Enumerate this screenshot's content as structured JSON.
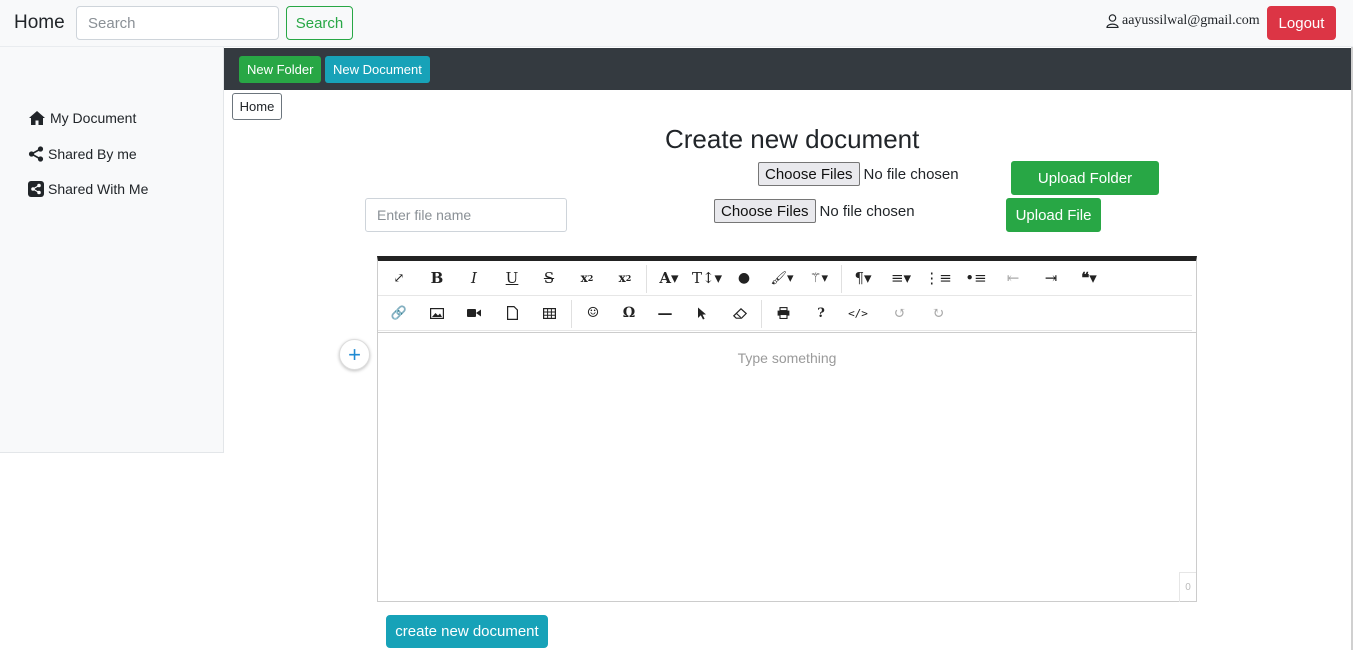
{
  "navbar": {
    "brand": "Home",
    "search_placeholder": "Search",
    "search_label": "Search",
    "user_email": "aayussilwal@gmail.com",
    "logout_label": "Logout"
  },
  "sidebar": {
    "items": [
      {
        "label": "My Document",
        "icon": "home-icon"
      },
      {
        "label": "Shared By me",
        "icon": "share-icon"
      },
      {
        "label": "Shared With Me",
        "icon": "share-square-icon"
      }
    ]
  },
  "toolbar": {
    "new_folder_label": "New Folder",
    "new_document_label": "New Document"
  },
  "breadcrumb": {
    "home": "Home"
  },
  "main": {
    "title": "Create new document",
    "folder_file_input": {
      "button": "Choose Files",
      "status": "No file chosen"
    },
    "upload_folder_label": "Upload Folder",
    "file_input": {
      "button": "Choose Files",
      "status": "No file chosen"
    },
    "upload_file_label": "Upload File",
    "filename_placeholder": "Enter file name",
    "editor": {
      "placeholder": "Type something",
      "char_count": "0",
      "toolbar_row1": [
        "fullscreen",
        "bold",
        "italic",
        "underline",
        "strikethrough",
        "subscript",
        "superscript",
        "font-family",
        "font-size",
        "color",
        "paint-brush",
        "magic-wand",
        "paragraph",
        "align",
        "ordered-list",
        "unordered-list",
        "outdent",
        "indent",
        "quote"
      ],
      "toolbar_row2": [
        "link",
        "image",
        "video",
        "file",
        "table",
        "emoticon",
        "special-char",
        "horizontal-line",
        "select-all",
        "clear-formatting",
        "print",
        "help",
        "html",
        "undo",
        "redo"
      ]
    },
    "create_label": "create new document"
  },
  "colors": {
    "success": "#28a745",
    "info": "#17a2b8",
    "danger": "#dc3545",
    "dark": "#343a40"
  }
}
